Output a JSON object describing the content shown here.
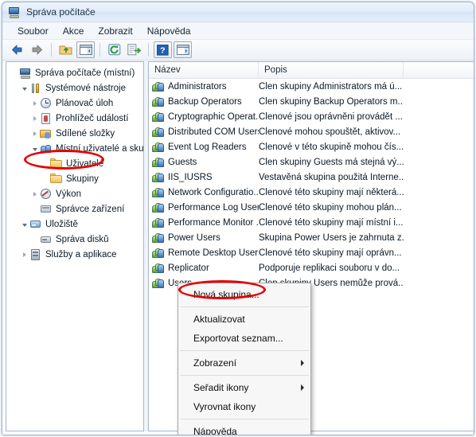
{
  "window": {
    "title": "Správa počítače",
    "title_icon": "computer-management-icon"
  },
  "menubar": {
    "items": [
      {
        "label": "Soubor",
        "name": "menu-soubor"
      },
      {
        "label": "Akce",
        "name": "menu-akce"
      },
      {
        "label": "Zobrazit",
        "name": "menu-zobrazit"
      },
      {
        "label": "Nápověda",
        "name": "menu-napoveda"
      }
    ]
  },
  "toolbar": {
    "buttons": [
      {
        "name": "back-button",
        "icon": "arrow-left-icon",
        "label": "Zpět"
      },
      {
        "name": "forward-button",
        "icon": "arrow-right-icon",
        "label": "Vpřed"
      },
      {
        "name": "up-folder-button",
        "icon": "folder-up-icon",
        "label": "Nahoru"
      },
      {
        "name": "show-hide-tree-button",
        "icon": "console-tree-icon",
        "label": "Zobrazit či skrýt strom konzoly"
      },
      {
        "name": "refresh-button",
        "icon": "refresh-icon",
        "label": "Aktualizovat"
      },
      {
        "name": "export-list-button",
        "icon": "export-list-icon",
        "label": "Exportovat seznam"
      },
      {
        "name": "help-button",
        "icon": "help-question-icon",
        "label": "Nápověda"
      },
      {
        "name": "show-action-pane-button",
        "icon": "action-pane-icon",
        "label": "Zobrazit podokno akcí"
      }
    ]
  },
  "tree": {
    "nodes": [
      {
        "label": "Správa počítače (místní)",
        "indent": 0,
        "twisty": "none",
        "icon": "ic-computer",
        "icon_name": "computer-icon",
        "selected": false
      },
      {
        "label": "Systémové nástroje",
        "indent": 1,
        "twisty": "expanded",
        "icon": "ic-tools",
        "icon_name": "system-tools-icon",
        "selected": false
      },
      {
        "label": "Plánovač úloh",
        "indent": 2,
        "twisty": "collapsed",
        "icon": "ic-clock",
        "icon_name": "task-scheduler-clock-icon",
        "selected": false
      },
      {
        "label": "Prohlížeč událostí",
        "indent": 2,
        "twisty": "collapsed",
        "icon": "ic-evt",
        "icon_name": "event-viewer-icon",
        "selected": false
      },
      {
        "label": "Sdílené složky",
        "indent": 2,
        "twisty": "collapsed",
        "icon": "ic-shared",
        "icon_name": "shared-folders-icon",
        "selected": false
      },
      {
        "label": "Místní uživatelé a skupiny",
        "indent": 2,
        "twisty": "expanded",
        "icon": "ic-users",
        "icon_name": "local-users-groups-icon",
        "selected": false
      },
      {
        "label": "Uživatelé",
        "indent": 3,
        "twisty": "none",
        "icon": "ic-folder",
        "icon_name": "folder-icon",
        "selected": false
      },
      {
        "label": "Skupiny",
        "indent": 3,
        "twisty": "none",
        "icon": "ic-folder",
        "icon_name": "folder-icon",
        "selected": true
      },
      {
        "label": "Výkon",
        "indent": 2,
        "twisty": "collapsed",
        "icon": "ic-perf",
        "icon_name": "performance-icon",
        "selected": false
      },
      {
        "label": "Správce zařízení",
        "indent": 2,
        "twisty": "none",
        "icon": "ic-devmgr",
        "icon_name": "device-manager-icon",
        "selected": false
      },
      {
        "label": "Úložiště",
        "indent": 1,
        "twisty": "expanded",
        "icon": "ic-storage",
        "icon_name": "storage-icon",
        "selected": false
      },
      {
        "label": "Správa disků",
        "indent": 2,
        "twisty": "none",
        "icon": "ic-disk",
        "icon_name": "disk-management-icon",
        "selected": false
      },
      {
        "label": "Služby a aplikace",
        "indent": 1,
        "twisty": "collapsed",
        "icon": "ic-svc",
        "icon_name": "services-applications-icon",
        "selected": false
      }
    ]
  },
  "list": {
    "columns": [
      "Název",
      "Popis",
      ""
    ],
    "rows": [
      {
        "name": "Administrators",
        "desc": "Člen skupiny Administrators má ú..."
      },
      {
        "name": "Backup Operators",
        "desc": "Člen skupiny Backup Operators m..."
      },
      {
        "name": "Cryptographic Operat...",
        "desc": "Členové jsou oprávněni provádět ..."
      },
      {
        "name": "Distributed COM Users",
        "desc": "Členové mohou spouštět, aktivov..."
      },
      {
        "name": "Event Log Readers",
        "desc": "Členové v této skupině mohou čís..."
      },
      {
        "name": "Guests",
        "desc": "Člen skupiny Guests má stejná vý..."
      },
      {
        "name": "IIS_IUSRS",
        "desc": "Vestavěná skupina použitá Interne..."
      },
      {
        "name": "Network Configuratio...",
        "desc": "Členové této skupiny mají některá..."
      },
      {
        "name": "Performance Log Users",
        "desc": "Členové této skupiny mohou plán..."
      },
      {
        "name": "Performance Monitor ...",
        "desc": "Členové této skupiny mají místní i..."
      },
      {
        "name": "Power Users",
        "desc": "Skupina Power Users je zahrnuta z..."
      },
      {
        "name": "Remote Desktop Users",
        "desc": "Členové této skupiny mají oprávn..."
      },
      {
        "name": "Replicator",
        "desc": "Podporuje replikaci souboru v do..."
      },
      {
        "name": "Users",
        "desc": "Člen skupiny Users nemůže prová..."
      }
    ]
  },
  "context_menu": {
    "items": [
      {
        "label": "Nová skupina...",
        "name": "ctx-nova-skupina",
        "submenu": false,
        "separator_after": true
      },
      {
        "label": "Aktualizovat",
        "name": "ctx-aktualizovat",
        "submenu": false,
        "separator_after": false
      },
      {
        "label": "Exportovat seznam...",
        "name": "ctx-exportovat-seznam",
        "submenu": false,
        "separator_after": true
      },
      {
        "label": "Zobrazení",
        "name": "ctx-zobrazeni",
        "submenu": true,
        "separator_after": true
      },
      {
        "label": "Seřadit ikony",
        "name": "ctx-seradit-ikony",
        "submenu": true,
        "separator_after": false
      },
      {
        "label": "Vyrovnat ikony",
        "name": "ctx-vyrovnat-ikony",
        "submenu": false,
        "separator_after": true
      },
      {
        "label": "Nápověda",
        "name": "ctx-napoveda",
        "submenu": false,
        "separator_after": false
      }
    ]
  },
  "annotations": {
    "color": "#e40000",
    "highlight_tree_item": "Skupiny",
    "highlight_menu_item": "Nová skupina..."
  }
}
